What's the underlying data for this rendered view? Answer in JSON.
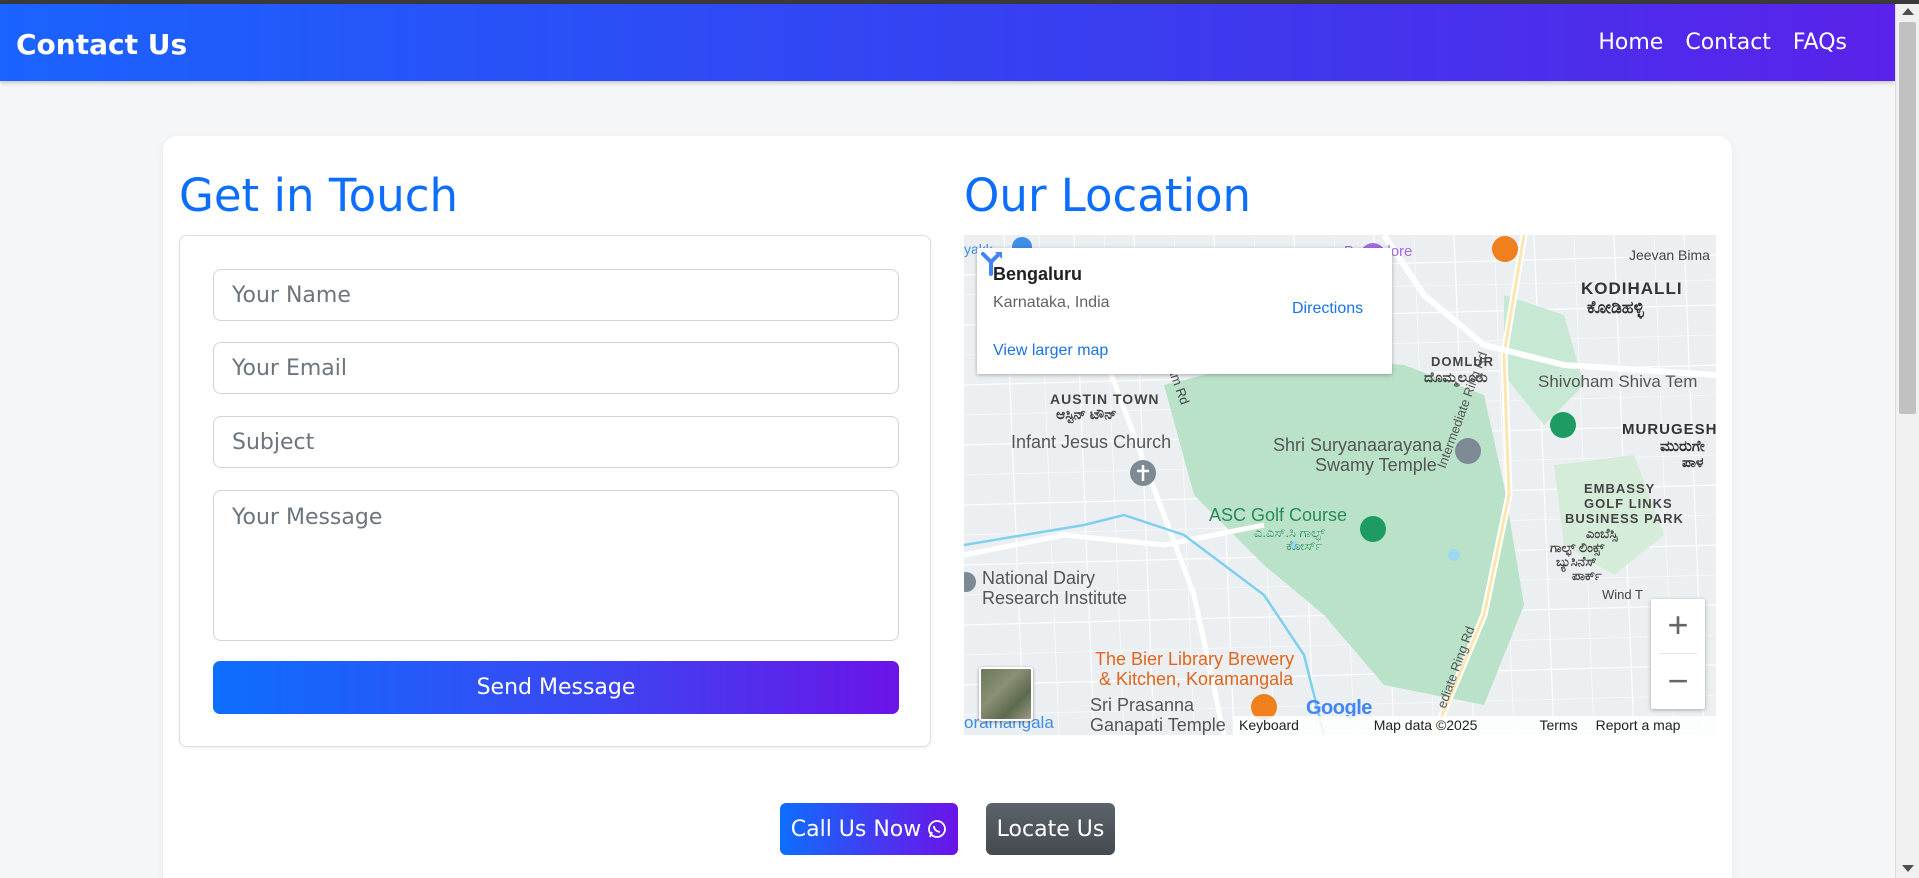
{
  "navbar": {
    "brand": "Contact Us",
    "links": [
      "Home",
      "Contact",
      "FAQs"
    ]
  },
  "contact": {
    "title": "Get in Touch",
    "fields": {
      "name_placeholder": "Your Name",
      "email_placeholder": "Your Email",
      "subject_placeholder": "Subject",
      "message_placeholder": "Your Message"
    },
    "submit_label": "Send Message"
  },
  "location": {
    "title": "Our Location",
    "info_card": {
      "place": "Bengaluru",
      "region": "Karnataka, India",
      "directions_label": "Directions",
      "larger_map_label": "View larger map"
    },
    "map_labels": {
      "kodihalli": "KODIHALLI",
      "kodihalli_kn": "ಕೋಡಿಹಳ್ಳಿ",
      "jeevan_bima": "Jeevan Bima",
      "domlur": "DOMLUR",
      "domlur_kn": "ದೊಮ್ಮಲೂರು",
      "shivoham": "Shivoham Shiva Tem",
      "murugesh": "MURUGESH",
      "murugesh_kn": "ಮುರುಗೇ",
      "murugesh_kn2": "ಪಾಳ",
      "austin_town": "AUSTIN TOWN",
      "austin_town_kn": "ಆಸ್ಟಿನ್ ಟೌನ್",
      "infant_jesus": "Infant Jesus Church",
      "suryanaarayana_1": "Shri Suryanaarayana",
      "suryanaarayana_2": "Swamy Temple",
      "embassy_1": "EMBASSY",
      "embassy_2": "GOLF LINKS",
      "embassy_3": "BUSINESS PARK",
      "embassy_kn_1": "ಎಂಬೆಸ್ಸಿ",
      "embassy_kn_2": "ಗಾಲ್ಫ್ ಲಿಂಕ್ಸ್",
      "embassy_kn_3": "ಬ್ಯುಸಿನೆಸ್",
      "embassy_kn_4": "ಪಾರ್ಕ್",
      "asc_golf": "ASC Golf Course",
      "asc_golf_kn_1": "ಎ.ಎಸ್.ಸಿ ಗಾಲ್ಫ್",
      "asc_golf_kn_2": "ಕೋರ್ಸ್",
      "intermediate_ring": "Intermediate Ring Rd",
      "intermediate_ring_2": "ediate Ring Rd",
      "ndri_1": "National Dairy",
      "ndri_2": "Research Institute",
      "bier_1": "The Bier Library Brewery",
      "bier_2": "& Kitchen, Koramangala",
      "prasanna_1": "Sri Prasanna",
      "prasanna_2": "Ganapati Temple",
      "koramangala": "oramangala",
      "ram_rd": "aram Rd",
      "bangalore": "Bangalore",
      "wind_t": "Wind T",
      "yakk": "yakk"
    },
    "zoom_in": "+",
    "zoom_out": "−",
    "google": "Google",
    "attribution": [
      "Keyboard shortcuts",
      "Map data ©2025 Google",
      "Terms",
      "Report a map error"
    ]
  },
  "actions": {
    "call_label": "Call Us Now",
    "locate_label": "Locate Us"
  },
  "colors": {
    "accent": "#0d6efd",
    "gradient_end": "#6a14e8",
    "map_green": "#b8e0c6"
  }
}
